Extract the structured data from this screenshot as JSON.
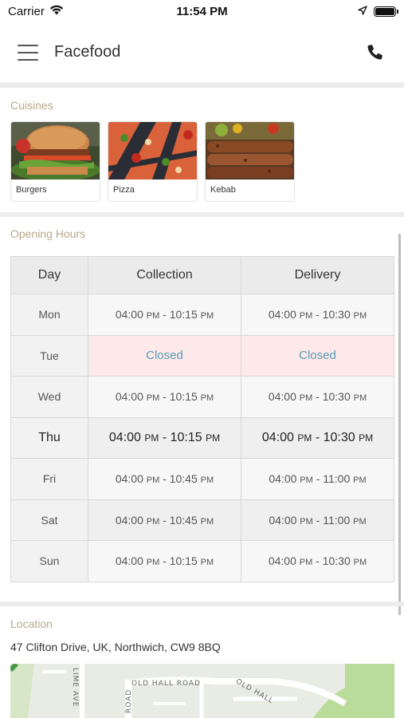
{
  "status_bar": {
    "carrier": "Carrier",
    "time": "11:54 PM"
  },
  "header": {
    "title": "Facefood"
  },
  "cuisines": {
    "label": "Cuisines",
    "items": [
      {
        "name": "Burgers"
      },
      {
        "name": "Pizza"
      },
      {
        "name": "Kebab"
      }
    ]
  },
  "opening_hours": {
    "label": "Opening Hours",
    "columns": [
      "Day",
      "Collection",
      "Delivery"
    ],
    "rows": [
      {
        "day": "Mon",
        "collection": {
          "open": "04:00",
          "open_ampm": "PM",
          "close": "10:15",
          "close_ampm": "PM"
        },
        "delivery": {
          "open": "04:00",
          "open_ampm": "PM",
          "close": "10:30",
          "close_ampm": "PM"
        }
      },
      {
        "day": "Tue",
        "collection_closed": "Closed",
        "delivery_closed": "Closed"
      },
      {
        "day": "Wed",
        "collection": {
          "open": "04:00",
          "open_ampm": "PM",
          "close": "10:15",
          "close_ampm": "PM"
        },
        "delivery": {
          "open": "04:00",
          "open_ampm": "PM",
          "close": "10:30",
          "close_ampm": "PM"
        }
      },
      {
        "day": "Thu",
        "collection": {
          "open": "04:00",
          "open_ampm": "PM",
          "close": "10:15",
          "close_ampm": "PM"
        },
        "delivery": {
          "open": "04:00",
          "open_ampm": "PM",
          "close": "10:30",
          "close_ampm": "PM"
        }
      },
      {
        "day": "Fri",
        "collection": {
          "open": "04:00",
          "open_ampm": "PM",
          "close": "10:45",
          "close_ampm": "PM"
        },
        "delivery": {
          "open": "04:00",
          "open_ampm": "PM",
          "close": "11:00",
          "close_ampm": "PM"
        }
      },
      {
        "day": "Sat",
        "collection": {
          "open": "04:00",
          "open_ampm": "PM",
          "close": "10:45",
          "close_ampm": "PM"
        },
        "delivery": {
          "open": "04:00",
          "open_ampm": "PM",
          "close": "11:00",
          "close_ampm": "PM"
        }
      },
      {
        "day": "Sun",
        "collection": {
          "open": "04:00",
          "open_ampm": "PM",
          "close": "10:15",
          "close_ampm": "PM"
        },
        "delivery": {
          "open": "04:00",
          "open_ampm": "PM",
          "close": "10:30",
          "close_ampm": "PM"
        }
      }
    ]
  },
  "location": {
    "label": "Location",
    "address": "47 Clifton Drive, UK, Northwich, CW9 8BQ",
    "map_labels": {
      "lime_ave": "LIME AVE",
      "road": "ROAD",
      "old_hall_road": "OLD HALL ROAD",
      "old_hall": "OLD HALL"
    }
  },
  "colors": {
    "section_label": "#b8a98a",
    "closed_bg": "#fde9e9",
    "closed_text": "#5b9bb5"
  },
  "icons": {
    "menu": "hamburger-icon",
    "call": "phone-icon",
    "wifi": "wifi-icon",
    "location": "location-arrow-icon",
    "battery": "battery-icon"
  }
}
